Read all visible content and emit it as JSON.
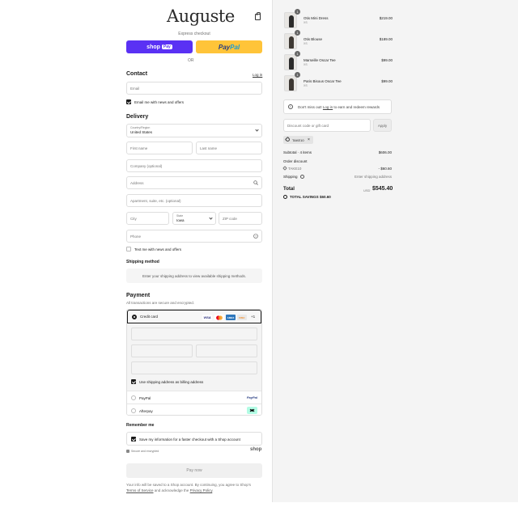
{
  "header": {
    "logo": "Auguste"
  },
  "express": {
    "label": "Express checkout",
    "shop_pay": "shop",
    "shop_pay_badge": "Pay",
    "paypal_a": "Pay",
    "paypal_b": "Pal",
    "or": "OR"
  },
  "contact": {
    "title": "Contact",
    "login": "Log in",
    "email_placeholder": "Email",
    "news_label": "Email me with news and offers"
  },
  "delivery": {
    "title": "Delivery",
    "country_label": "Country/Region",
    "country_value": "United States",
    "first_name": "First name",
    "last_name": "Last name",
    "company": "Company (optional)",
    "address": "Address",
    "apartment": "Apartment, suite, etc. (optional)",
    "city": "City",
    "state_label": "State",
    "state_value": "Iowa",
    "zip": "ZIP code",
    "phone": "Phone",
    "text_label": "Text me with news and offers"
  },
  "shipping": {
    "title": "Shipping method",
    "notice": "Enter your shipping address to view available shipping methods."
  },
  "payment": {
    "title": "Payment",
    "subtitle": "All transactions are secure and encrypted.",
    "credit_card": "Credit card",
    "brands": [
      "VISA",
      "MC",
      "AMEX",
      "DISC"
    ],
    "more": "+1",
    "billing_label": "Use shipping address as billing address",
    "paypal": "PayPal",
    "paypal_logo": "PayPal",
    "afterpay": "Afterpay"
  },
  "remember": {
    "title": "Remember me",
    "save_label": "Save my information for a faster checkout with a Shop account",
    "secure": "Secure and encrypted",
    "shop": "shop"
  },
  "pay_now": "Pay now",
  "legal": {
    "text": "Your info will be saved to a Shop account. By continuing, you agree to Shop's",
    "terms": "Terms of Service",
    "and": "and acknowledge the",
    "privacy": "Privacy Policy",
    "end": "."
  },
  "cart": {
    "items": [
      {
        "qty": "1",
        "name": "Otis Mini Dress",
        "variant": "XS",
        "price": "$219.00"
      },
      {
        "qty": "1",
        "name": "Otis Blouse",
        "variant": "XS",
        "price": "$189.00"
      },
      {
        "qty": "1",
        "name": "Marseille Oscar Tee",
        "variant": "XS",
        "price": "$99.00"
      },
      {
        "qty": "1",
        "name": "Paris Bisous Oscar Tee",
        "variant": "XS",
        "price": "$99.00"
      }
    ],
    "promo_a": "Don't miss out!",
    "promo_login": "Log in",
    "promo_b": "to earn and redeem rewards",
    "discount_placeholder": "Discount code or gift card",
    "apply": "Apply",
    "tag": "TAKE10",
    "subtotal_label": "Subtotal · 4 items",
    "subtotal_value": "$606.00",
    "order_discount": "Order discount",
    "discount_code": "TAKE10",
    "discount_value": "- $60.60",
    "shipping_label": "Shipping",
    "shipping_value": "Enter shipping address",
    "total_label": "Total",
    "currency": "USD",
    "total_value": "$545.40",
    "savings_label": "TOTAL SAVINGS",
    "savings_value": "$60.60"
  },
  "colors": {
    "shop_pay": "#5a31f4",
    "paypal": "#ffc439",
    "afterpay": "#b2fce4"
  }
}
